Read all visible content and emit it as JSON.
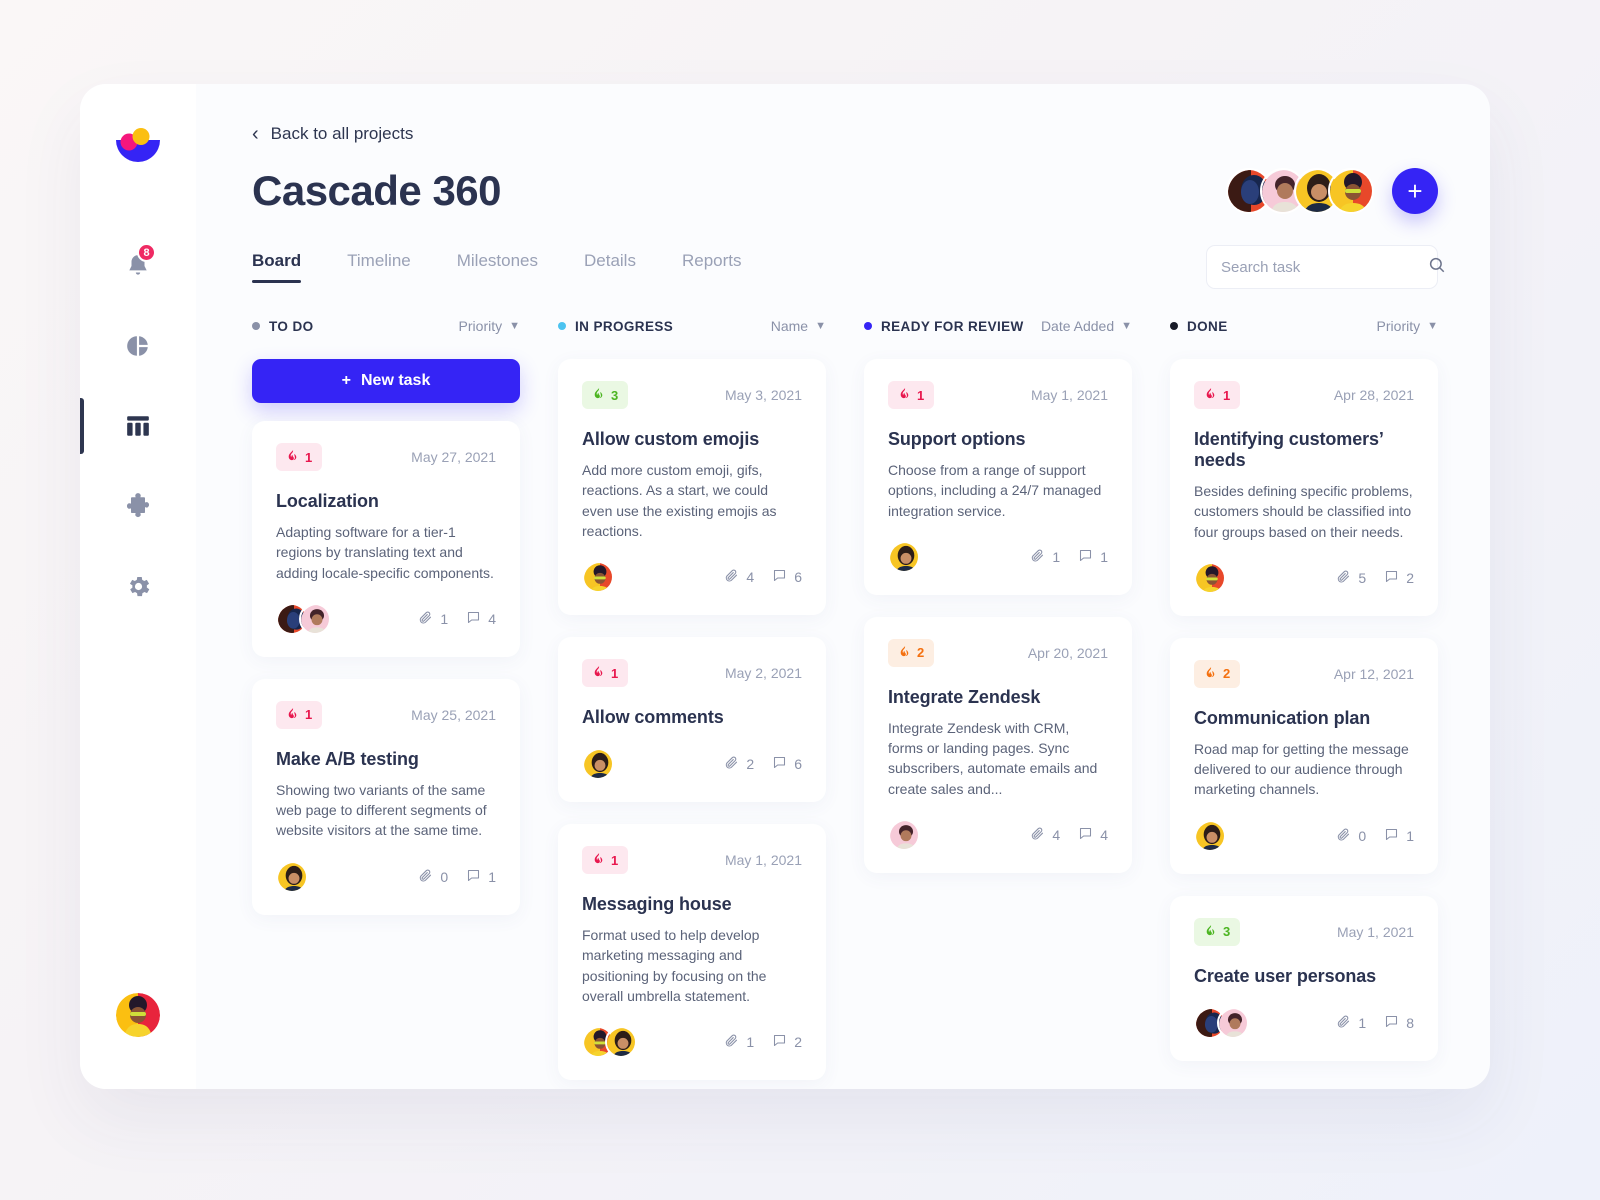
{
  "sidebar": {
    "logo_name": "logo",
    "items": [
      {
        "name": "notifications",
        "icon": "bell-icon",
        "badge": "8"
      },
      {
        "name": "analytics",
        "icon": "pie-chart-icon",
        "badge": ""
      },
      {
        "name": "board",
        "icon": "board-icon",
        "badge": "",
        "active": true
      },
      {
        "name": "integrations",
        "icon": "puzzle-icon",
        "badge": ""
      },
      {
        "name": "settings",
        "icon": "gear-icon",
        "badge": ""
      }
    ],
    "profile_avatar": "user-avatar"
  },
  "header": {
    "back_label": "Back to all projects",
    "back_icon": "chevron-left-icon",
    "title": "Cascade 360",
    "add_button_label": "+",
    "members": [
      "member-1",
      "member-2",
      "member-3",
      "member-4"
    ]
  },
  "tabs": [
    {
      "label": "Board",
      "active": true
    },
    {
      "label": "Timeline",
      "active": false
    },
    {
      "label": "Milestones",
      "active": false
    },
    {
      "label": "Details",
      "active": false
    },
    {
      "label": "Reports",
      "active": false
    }
  ],
  "search": {
    "placeholder": "Search task",
    "value": "",
    "icon": "search-icon"
  },
  "new_task": {
    "label": "New task",
    "icon": "plus-icon"
  },
  "colors": {
    "accent": "#3524f5",
    "todo_dot": "#8a91a8",
    "inprogress_dot": "#4cc3f0",
    "review_dot": "#3524f5",
    "done_dot": "#181b28",
    "priority_1_bg": "#fde8ef",
    "priority_1_fg": "#e8174e",
    "priority_2_bg": "#fdeee2",
    "priority_2_fg": "#f4700f",
    "priority_3_bg": "#eaf8e3",
    "priority_3_fg": "#4cb521",
    "title": "#2b3350"
  },
  "columns": [
    {
      "name": "TO DO",
      "dot_color": "#8a91a8",
      "sort_label": "Priority",
      "has_new_task_button": true,
      "cards": [
        {
          "priority": "1",
          "priority_level": 1,
          "date": "May 27, 2021",
          "title": "Localization",
          "description": "Adapting software for a tier-1 regions by translating text and adding locale-specific components.",
          "attachments": "1",
          "comments": "4",
          "assignees": [
            "av-red",
            "av-pink"
          ]
        },
        {
          "priority": "1",
          "priority_level": 1,
          "date": "May 25, 2021",
          "title": "Make A/B testing",
          "description": "Showing two variants of the same web page to different segments of website visitors at the same time.",
          "attachments": "0",
          "comments": "1",
          "assignees": [
            "av-yellow"
          ]
        }
      ]
    },
    {
      "name": "IN PROGRESS",
      "dot_color": "#4cc3f0",
      "sort_label": "Name",
      "has_new_task_button": false,
      "cards": [
        {
          "priority": "3",
          "priority_level": 3,
          "date": "May 3, 2021",
          "title": "Allow custom emojis",
          "description": "Add more  custom emoji, gifs, reactions. As a start, we could even use the existing emojis as reactions.",
          "attachments": "4",
          "comments": "6",
          "assignees": [
            "av-sun"
          ]
        },
        {
          "priority": "1",
          "priority_level": 1,
          "date": "May 2, 2021",
          "title": "Allow comments",
          "description": "",
          "attachments": "2",
          "comments": "6",
          "assignees": [
            "av-yellow"
          ]
        },
        {
          "priority": "1",
          "priority_level": 1,
          "date": "May 1, 2021",
          "title": "Messaging house",
          "description": "Format used to help develop marketing messaging and positioning by focusing on the overall umbrella statement.",
          "attachments": "1",
          "comments": "2",
          "assignees": [
            "av-sun",
            "av-yellow"
          ]
        }
      ]
    },
    {
      "name": "READY FOR REVIEW",
      "dot_color": "#3524f5",
      "sort_label": "Date Added",
      "has_new_task_button": false,
      "cards": [
        {
          "priority": "1",
          "priority_level": 1,
          "date": "May 1, 2021",
          "title": "Support options",
          "description": "Choose from a range of support options, including a 24/7 managed integration service.",
          "attachments": "1",
          "comments": "1",
          "assignees": [
            "av-yellow"
          ]
        },
        {
          "priority": "2",
          "priority_level": 2,
          "date": "Apr 20, 2021",
          "title": "Integrate Zendesk",
          "description": "Integrate Zendesk with CRM, forms or landing pages. Sync subscribers, automate emails and create sales and...",
          "attachments": "4",
          "comments": "4",
          "assignees": [
            "av-pink"
          ]
        }
      ]
    },
    {
      "name": "DONE",
      "dot_color": "#181b28",
      "sort_label": "Priority",
      "has_new_task_button": false,
      "cards": [
        {
          "priority": "1",
          "priority_level": 1,
          "date": "Apr 28, 2021",
          "title": "Identifying customers’ needs",
          "description": "Besides defining specific problems, customers should be classified into four groups based on their needs.",
          "attachments": "5",
          "comments": "2",
          "assignees": [
            "av-sun"
          ]
        },
        {
          "priority": "2",
          "priority_level": 2,
          "date": "Apr 12, 2021",
          "title": "Communication plan",
          "description": "Road map for getting the message delivered to our audience through marketing channels.",
          "attachments": "0",
          "comments": "1",
          "assignees": [
            "av-yellow"
          ]
        },
        {
          "priority": "3",
          "priority_level": 3,
          "date": "May 1, 2021",
          "title": "Create user personas",
          "description": "",
          "attachments": "1",
          "comments": "8",
          "assignees": [
            "av-red",
            "av-pink"
          ]
        }
      ]
    }
  ]
}
